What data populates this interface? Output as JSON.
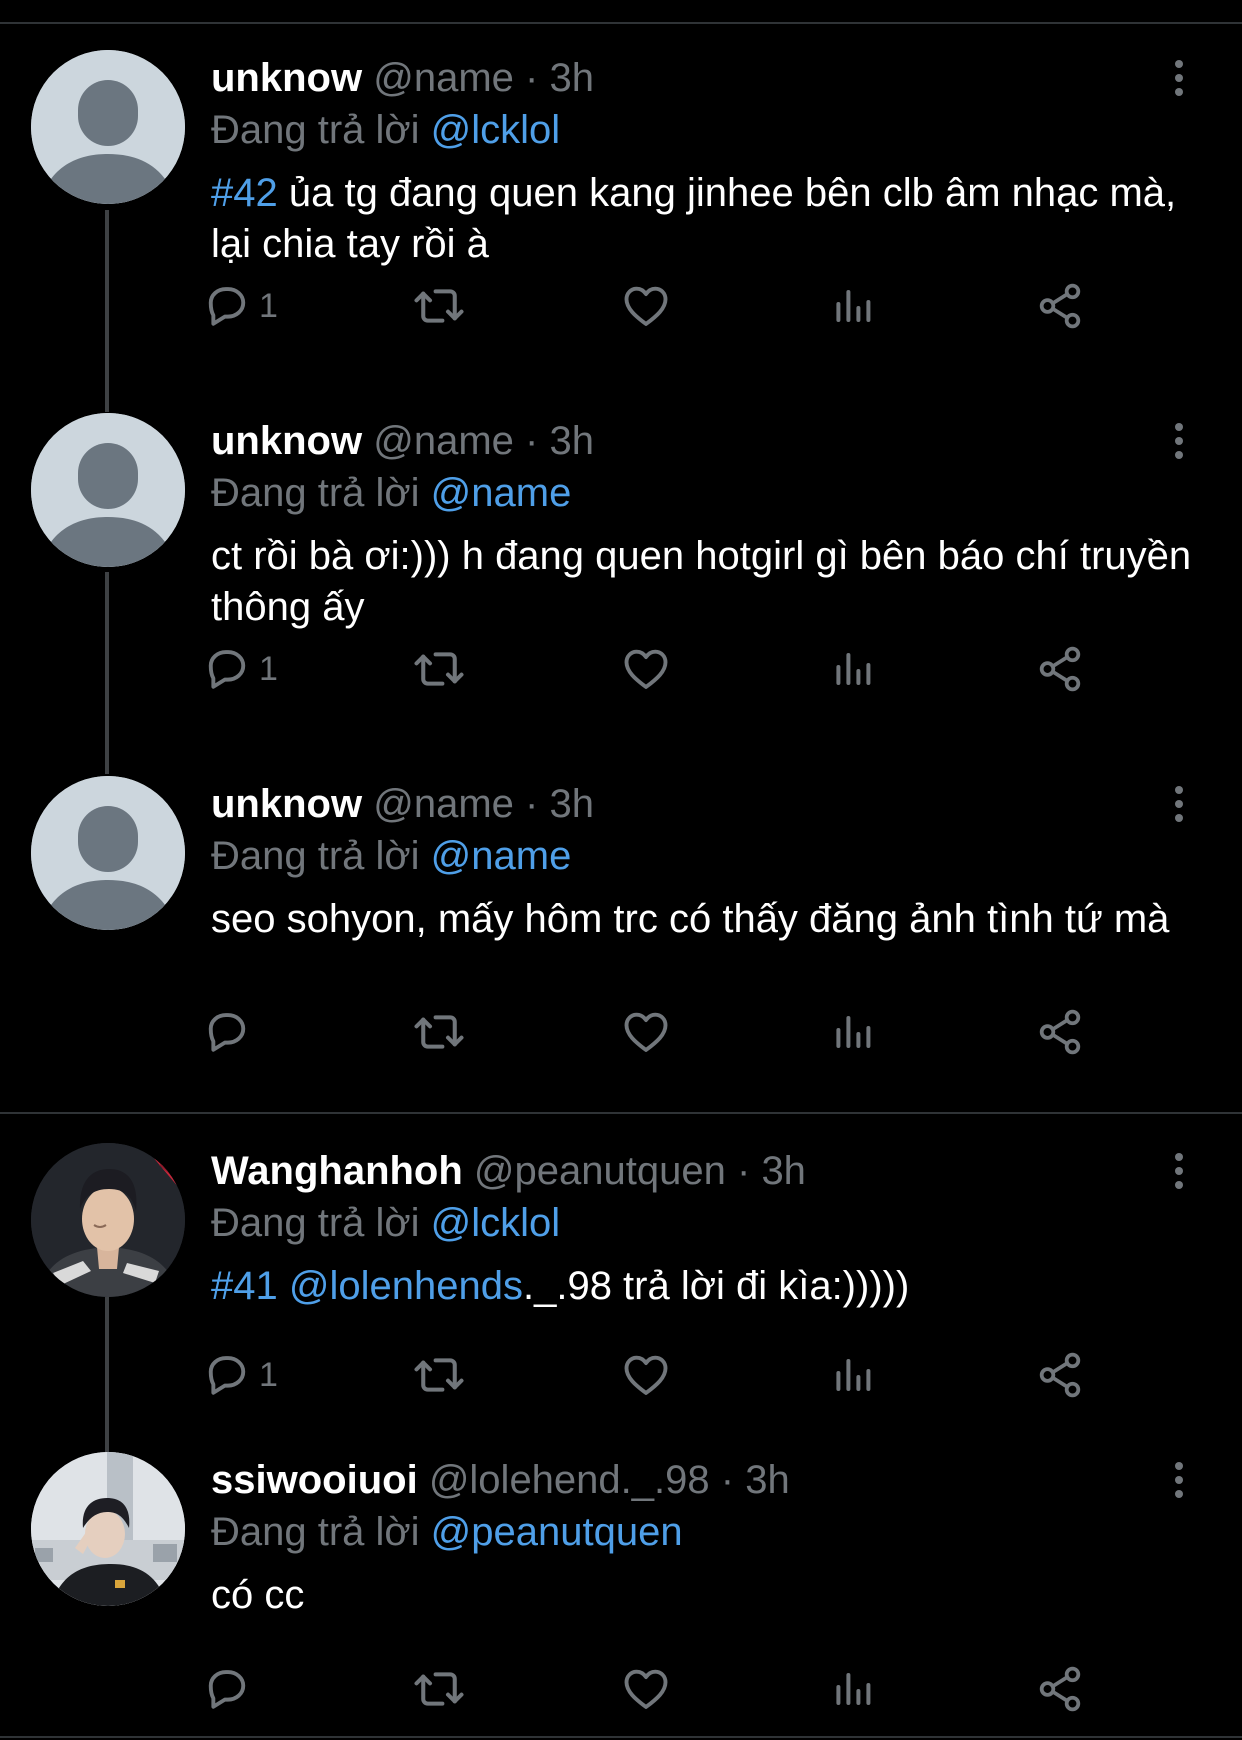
{
  "replying_label": "Đang trả lời",
  "icons": {
    "reply": "speech-bubble-icon",
    "retweet": "retweet-icon",
    "like": "heart-icon",
    "views": "bar-chart-icon",
    "share": "share-icon",
    "more": "vertical-dots-icon"
  },
  "colors": {
    "background": "#000000",
    "divider": "#2f3336",
    "link": "#4f9fe8",
    "muted": "#71767b",
    "text": "#ffffff"
  },
  "tweets": [
    {
      "display_name": "unknow",
      "handle": "@name",
      "dot": "·",
      "time": "3h",
      "replying_to": "@lcklol",
      "hashtag": "#42",
      "mention": "",
      "text": " ủa tg đang quen kang jinhee bên clb âm nhạc mà, lại chia tay rồi à",
      "reply_count": "1"
    },
    {
      "display_name": "unknow",
      "handle": "@name",
      "dot": "·",
      "time": "3h",
      "replying_to": "@name",
      "hashtag": "",
      "mention": "",
      "text": "ct rồi bà ơi:))) h đang quen hotgirl gì bên báo chí truyền thông ấy",
      "reply_count": "1"
    },
    {
      "display_name": "unknow",
      "handle": "@name",
      "dot": "·",
      "time": "3h",
      "replying_to": "@name",
      "hashtag": "",
      "mention": "",
      "text": "seo sohyon, mấy hôm trc có thấy đăng ảnh tình tứ mà",
      "reply_count": ""
    },
    {
      "display_name": "Wanghanhoh",
      "handle": "@peanutquen",
      "dot": "·",
      "time": "3h",
      "replying_to": "@lcklol",
      "hashtag": "#41",
      "mention": " @lolenhends",
      "text": "._.98 trả lời đi kìa:)))))",
      "reply_count": "1"
    },
    {
      "display_name": "ssiwooiuoi",
      "handle": "@lolehend._.98",
      "dot": "·",
      "time": "3h",
      "replying_to": "@peanutquen",
      "hashtag": "",
      "mention": "",
      "text": "có cc",
      "reply_count": ""
    }
  ]
}
